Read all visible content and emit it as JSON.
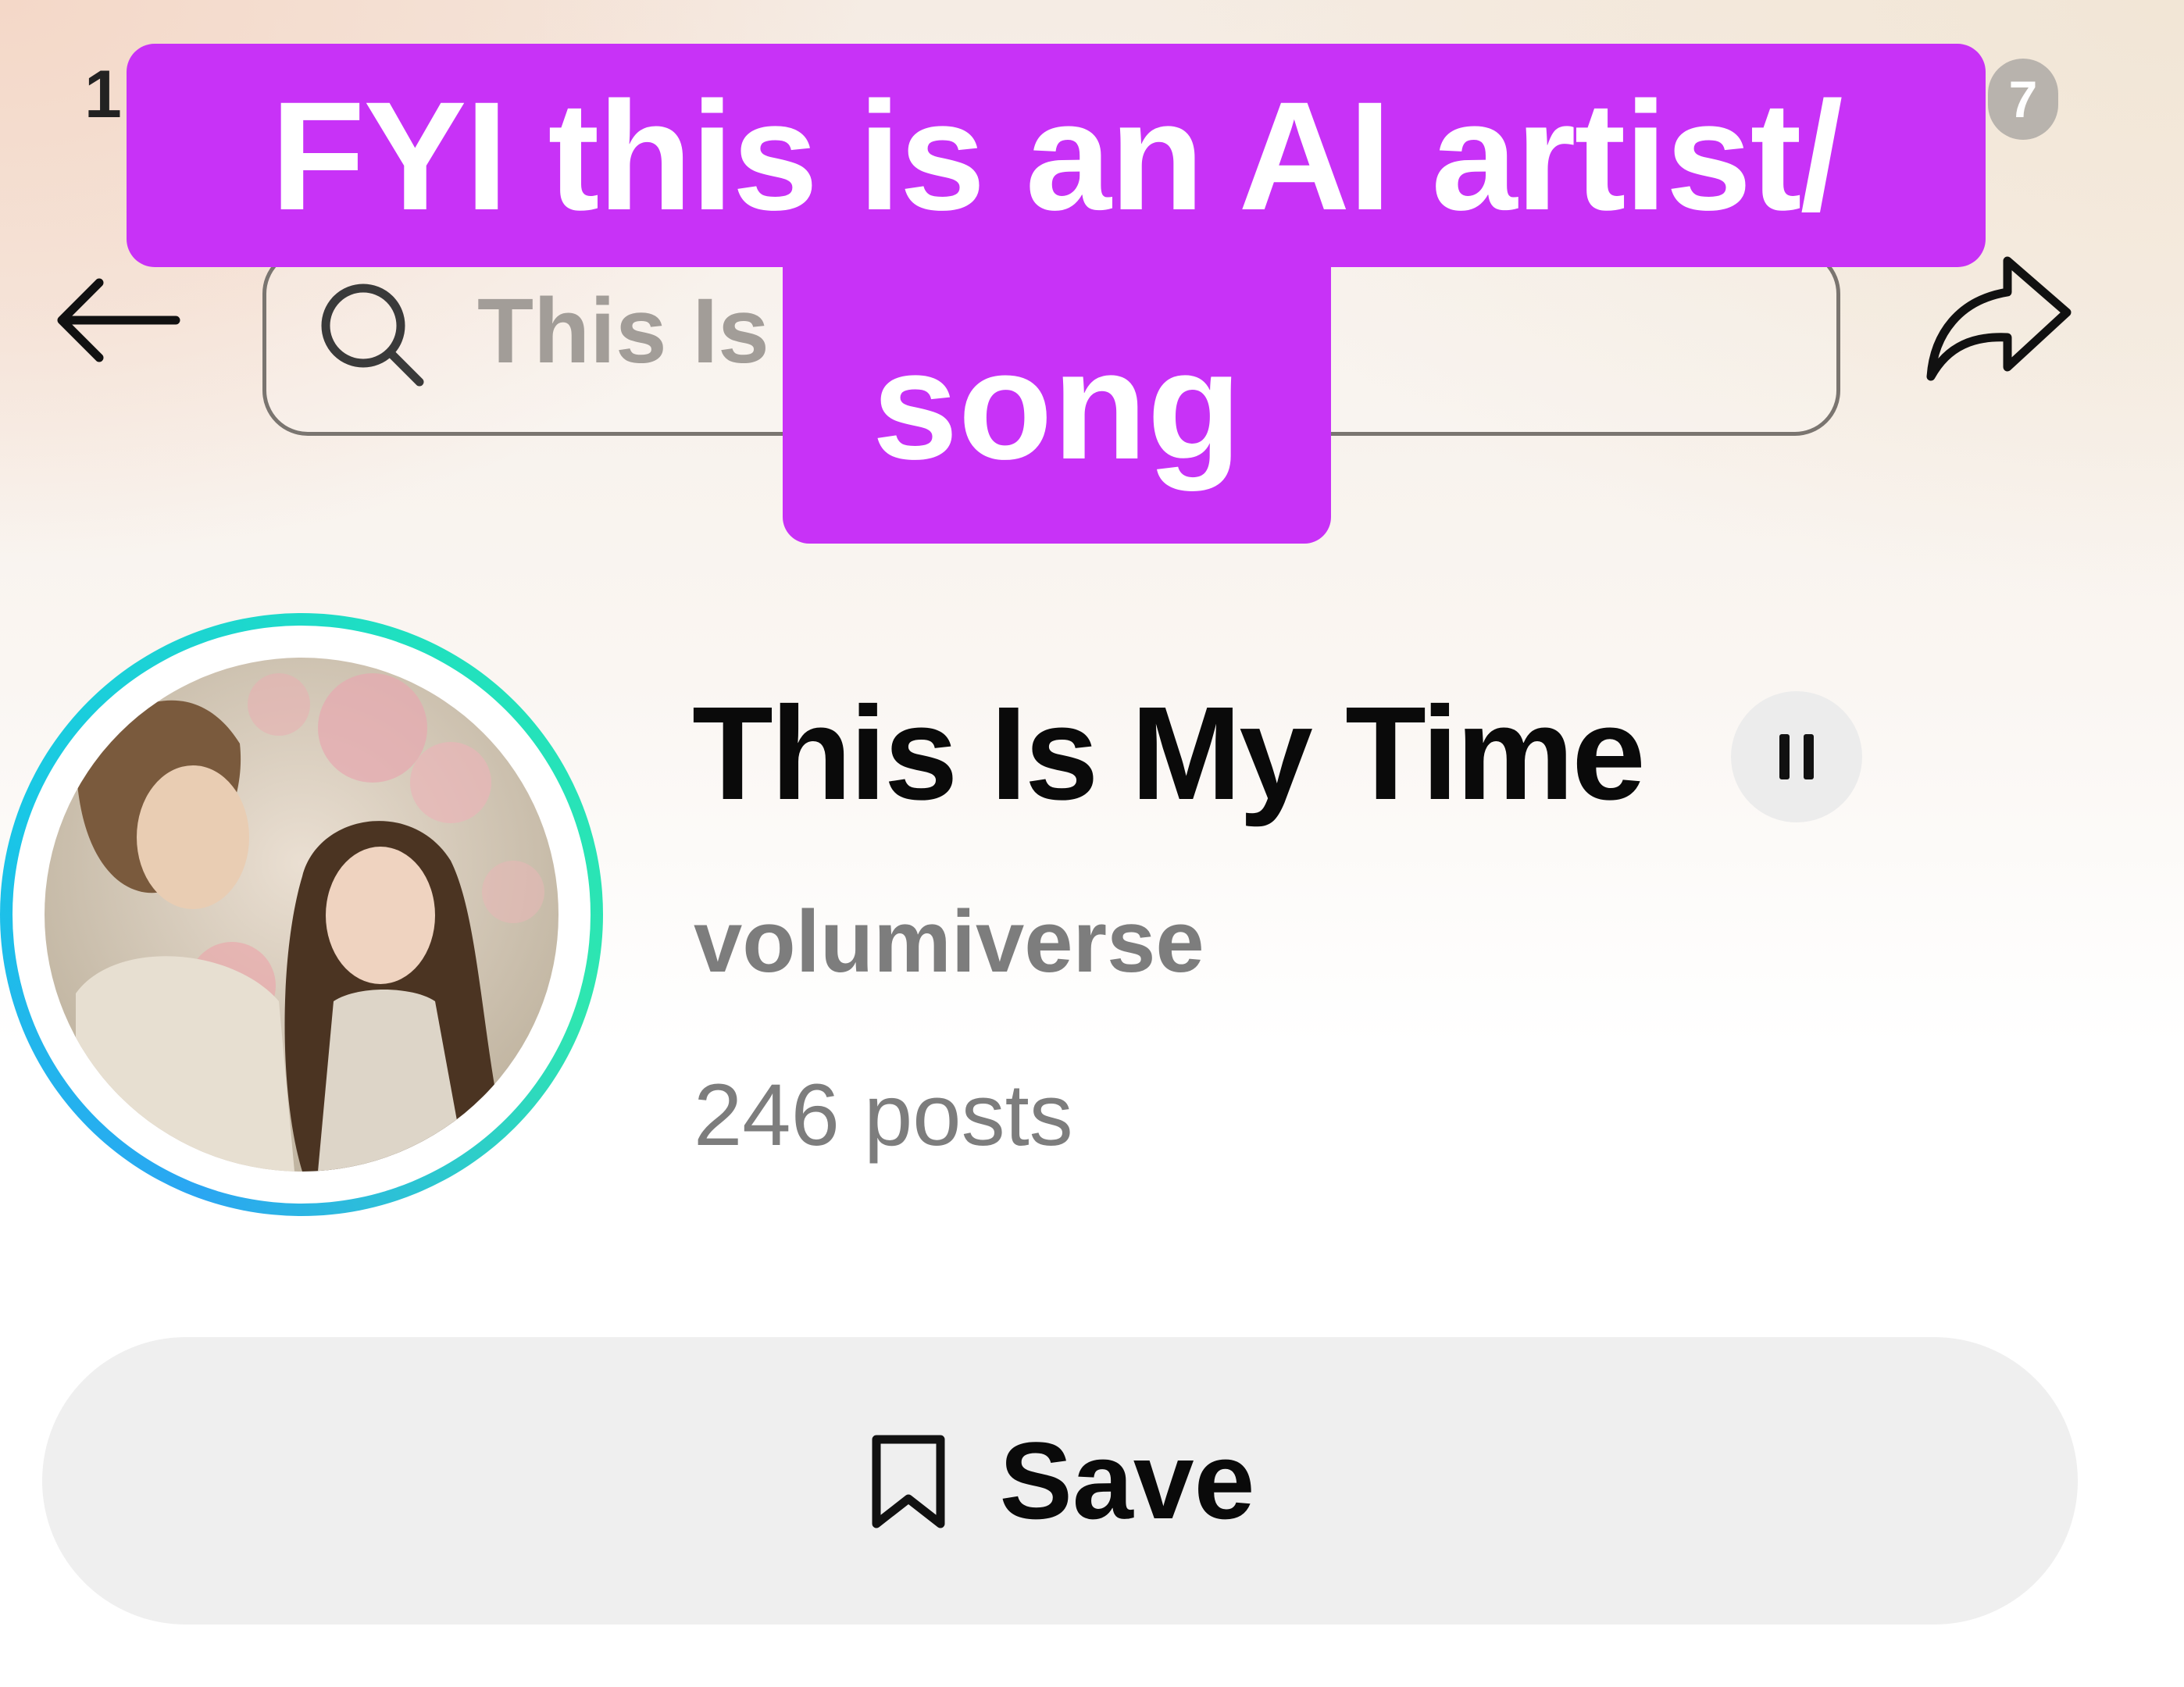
{
  "status_bar": {
    "time_partial": "1",
    "battery_partial": "7"
  },
  "top_bar": {
    "back_icon": "arrow-left-icon",
    "search_icon": "search-icon",
    "search_value": "This Is",
    "share_icon": "share-icon"
  },
  "caption": {
    "line1": "FYI this is an AI artist/",
    "line2": "song",
    "background_color": "#c832f7",
    "text_color": "#ffffff"
  },
  "song": {
    "title": "This Is My Time",
    "artist": "volumiverse",
    "post_count": "246 posts",
    "pause_icon": "pause-icon",
    "avatar_ring_colors": [
      "#2aa6f2",
      "#1fe0c0"
    ]
  },
  "actions": {
    "save_label": "Save",
    "save_icon": "bookmark-icon"
  }
}
